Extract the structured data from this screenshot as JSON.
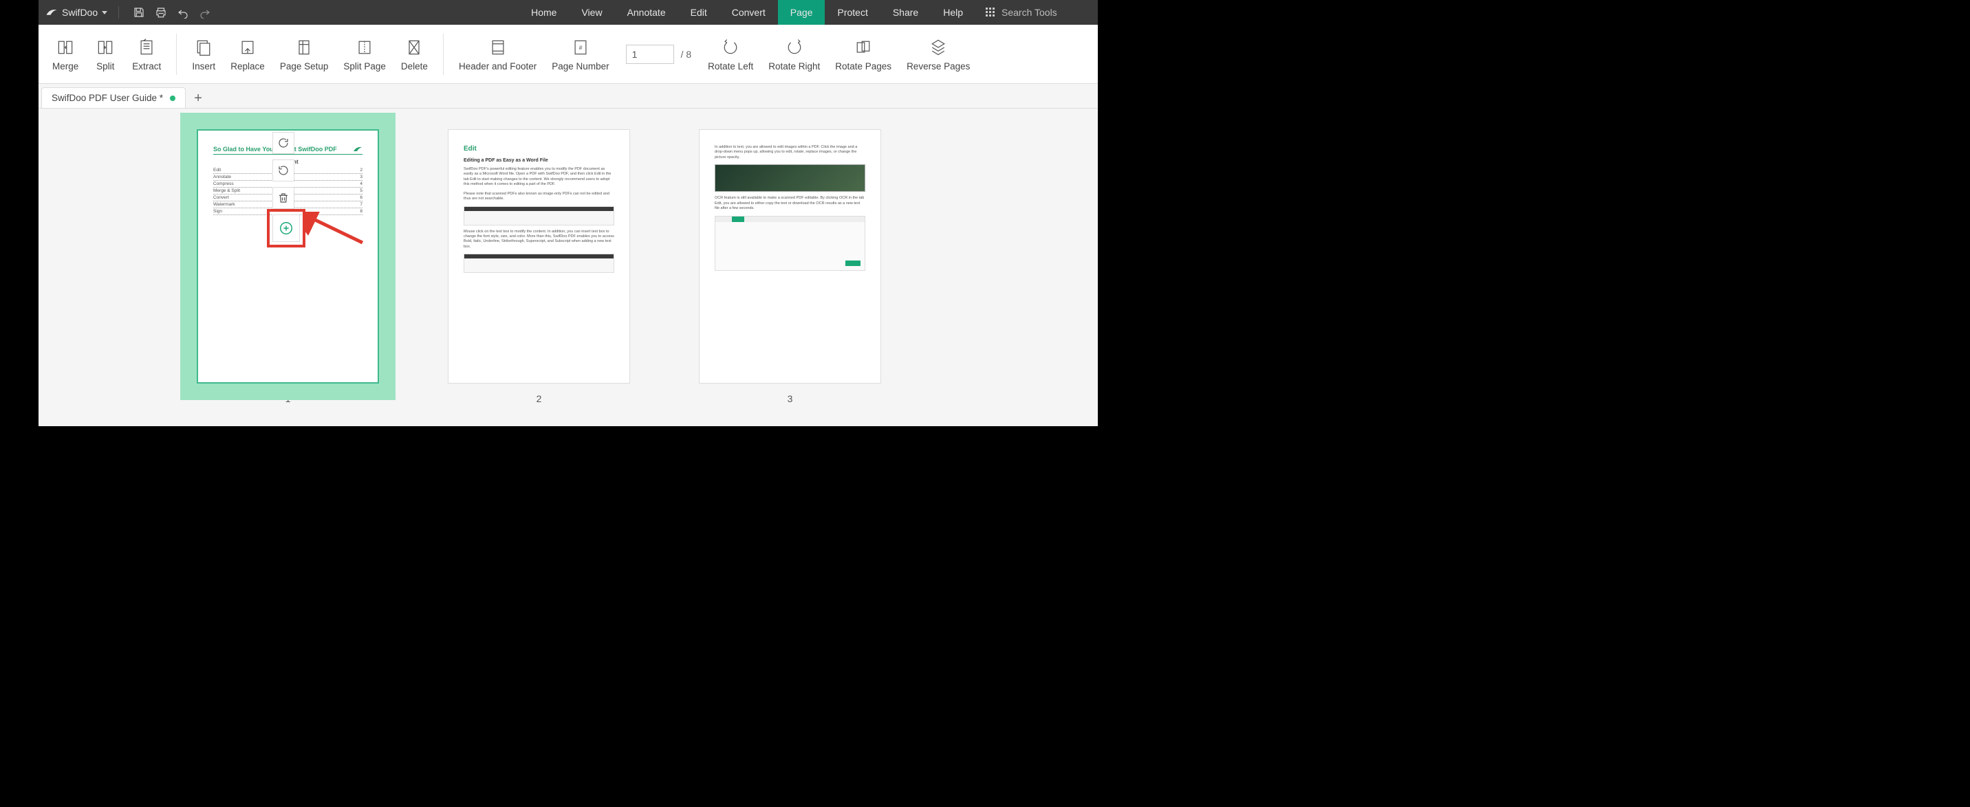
{
  "brand": "SwifDoo",
  "menu": {
    "home": "Home",
    "view": "View",
    "annotate": "Annotate",
    "edit": "Edit",
    "convert": "Convert",
    "page": "Page",
    "protect": "Protect",
    "share": "Share",
    "help": "Help"
  },
  "search_placeholder": "Search Tools",
  "ribbon": {
    "merge": "Merge",
    "split": "Split",
    "extract": "Extract",
    "insert": "Insert",
    "replace": "Replace",
    "page_setup": "Page Setup",
    "split_page": "Split Page",
    "delete": "Delete",
    "header_footer": "Header and Footer",
    "page_number": "Page Number",
    "rotate_left": "Rotate Left",
    "rotate_right": "Rotate Right",
    "rotate_pages": "Rotate Pages",
    "reverse_pages": "Reverse Pages"
  },
  "page_nav": {
    "current": "1",
    "total": "/ 8"
  },
  "tabs": {
    "doc": "SwifDoo PDF User Guide *"
  },
  "thumbs": {
    "n1": "1",
    "n2": "2",
    "n3": "3"
  },
  "page1": {
    "title": "So Glad to Have You Here at SwifDoo PDF",
    "content_label": "Content",
    "rows": [
      {
        "l": "Edit",
        "r": "2"
      },
      {
        "l": "Annotate",
        "r": "3"
      },
      {
        "l": "Compress",
        "r": "4"
      },
      {
        "l": "Merge & Split",
        "r": "5"
      },
      {
        "l": "Convert",
        "r": "6"
      },
      {
        "l": "Watermark",
        "r": "7"
      },
      {
        "l": "Sign",
        "r": "8"
      }
    ]
  },
  "page2": {
    "head": "Edit",
    "sub": "Editing a PDF as Easy as a Word File",
    "para1": "SwifDoo PDF's powerful editing feature enables you to modify the PDF document as easily as a Microsoft Word file. Open a PDF with SwifDoo PDF, and then click Edit in the tab Edit to start making changes to the content. We strongly recommend users to adopt this method when it comes to editing a part of the PDF.",
    "para2": "Please note that scanned PDFs also known as image-only PDFs can not be edited and thus are not searchable.",
    "para3": "Mouse click on the text box to modify the content. In addition, you can insert text box to change the font style, size, and color. More than this, SwifDoo PDF enables you to access Bold, Italic, Underline, Strikethrough, Superscript, and Subscript when adding a new text box."
  },
  "page3": {
    "para1": "In addition to text, you are allowed to edit images within a PDF. Click the image and a drop-down menu pops up, allowing you to edit, rotate, replace images, or change the picture opacity.",
    "para2": "OCR feature is still available to make a scanned PDF editable. By clicking OCR in the tab Edit, you are allowed to either copy the text or download the OCR results as a new text file after a few seconds."
  }
}
